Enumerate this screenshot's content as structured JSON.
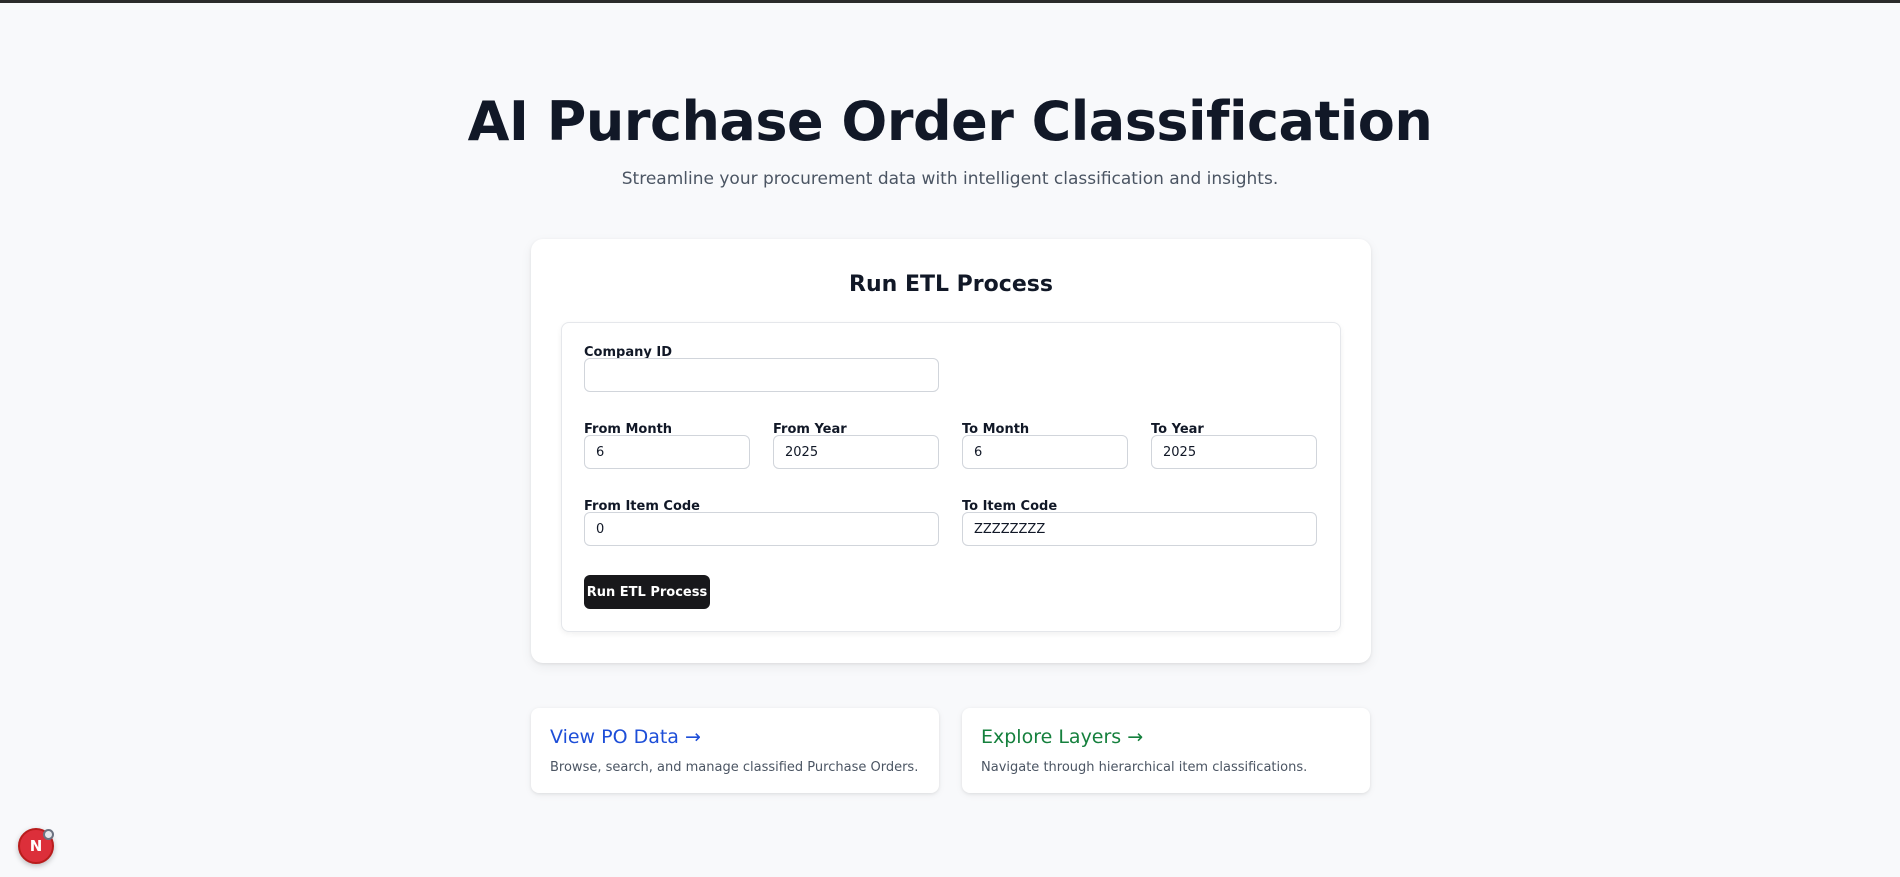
{
  "header": {
    "title": "AI Purchase Order Classification",
    "subtitle": "Streamline your procurement data with intelligent classification and insights."
  },
  "etl": {
    "title": "Run ETL Process",
    "company_id": {
      "label": "Company ID",
      "value": ""
    },
    "from_month": {
      "label": "From Month",
      "value": "6"
    },
    "from_year": {
      "label": "From Year",
      "value": "2025"
    },
    "to_month": {
      "label": "To Month",
      "value": "6"
    },
    "to_year": {
      "label": "To Year",
      "value": "2025"
    },
    "from_item_code": {
      "label": "From Item Code",
      "value": "0"
    },
    "to_item_code": {
      "label": "To Item Code",
      "value": "ZZZZZZZZ"
    },
    "run_button": "Run ETL Process"
  },
  "links": {
    "po_data": {
      "title": "View PO Data →",
      "description": "Browse, search, and manage classified Purchase Orders.",
      "color": "#1d4ed8"
    },
    "layers": {
      "title": "Explore Layers →",
      "description": "Navigate through hierarchical item classifications.",
      "color": "#15803d"
    }
  },
  "dev_badge": {
    "label": "N"
  }
}
